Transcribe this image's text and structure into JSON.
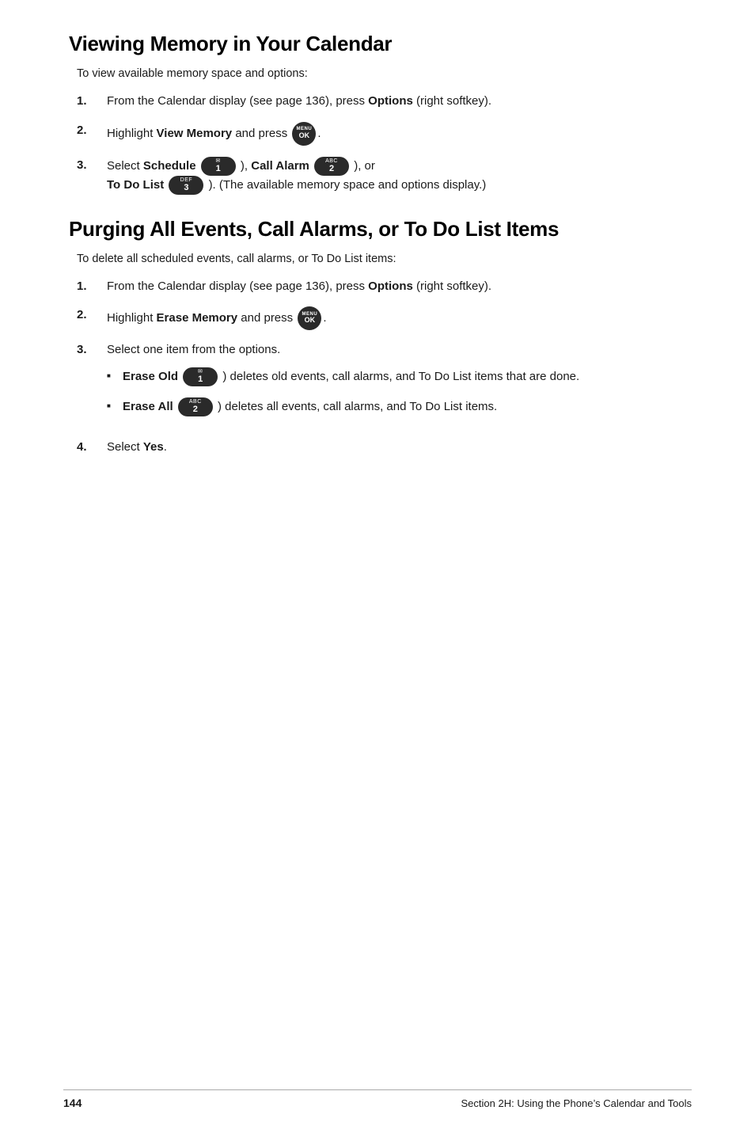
{
  "sections": [
    {
      "id": "viewing-memory",
      "title": "Viewing Memory in Your Calendar",
      "intro": "To view available memory space and options:",
      "steps": [
        {
          "num": "1.",
          "text_before": "From the Calendar display (see page 136), press ",
          "bold": "Options",
          "text_after": " (right softkey)."
        },
        {
          "num": "2.",
          "text_before": "Highlight ",
          "bold": "View Memory",
          "text_after": " and press",
          "has_menu_badge": true
        },
        {
          "num": "3.",
          "text_before": "Select ",
          "bold1": "Schedule",
          "badge1_top": "✉",
          "badge1_main": "1",
          "badge1_type": "oval",
          "text_mid1": "), ",
          "bold2": "Call Alarm",
          "badge2_top": "ABC",
          "badge2_main": "2",
          "badge2_type": "oval",
          "text_mid2": "), or",
          "newline": true,
          "bold3": "To Do List",
          "badge3_top": "DEF",
          "badge3_main": "3",
          "badge3_type": "oval",
          "text_end": "). (The available memory space and options display.)"
        }
      ]
    },
    {
      "id": "purging-all-events",
      "title": "Purging All Events, Call Alarms, or To Do List Items",
      "intro": "To delete all scheduled events, call alarms, or To Do List items:",
      "steps": [
        {
          "num": "1.",
          "text_before": "From the Calendar display (see page 136), press ",
          "bold": "Options",
          "text_after": " (right softkey)."
        },
        {
          "num": "2.",
          "text_before": "Highlight ",
          "bold": "Erase Memory",
          "text_after": " and press",
          "has_menu_badge": true
        },
        {
          "num": "3.",
          "text_plain": "Select one item from the options.",
          "has_sub": true,
          "sub_items": [
            {
              "bold": "Erase Old",
              "badge_top": "✉",
              "badge_main": "1",
              "badge_type": "oval",
              "text": ") deletes old events, call alarms, and To Do List items that are done."
            },
            {
              "bold": "Erase All",
              "badge_top": "ABC",
              "badge_main": "2",
              "badge_type": "oval",
              "text": ") deletes all events, call alarms, and To Do List items."
            }
          ]
        },
        {
          "num": "4.",
          "text_before": "Select ",
          "bold": "Yes",
          "text_after": "."
        }
      ]
    }
  ],
  "footer": {
    "page_number": "144",
    "section_text": "Section 2H: Using the Phone’s Calendar and Tools"
  },
  "menu_ok_label_top": "MENU",
  "menu_ok_label_bottom": "OK"
}
